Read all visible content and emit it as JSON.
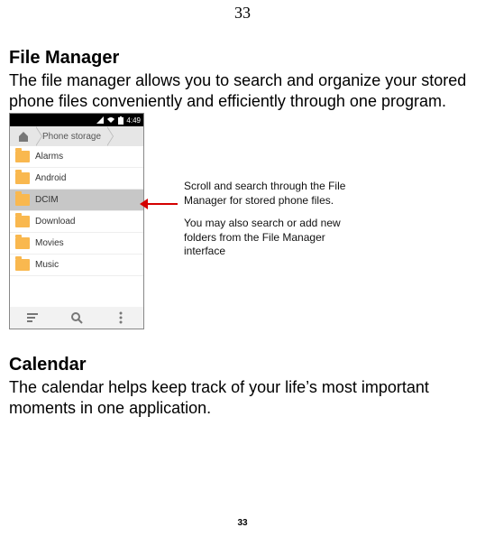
{
  "page_number_top": "33",
  "page_number_bottom": "33",
  "section1": {
    "title": "File Manager",
    "body": "The file manager allows you to search and organize your stored phone files conveniently and efficiently through one program."
  },
  "phone": {
    "breadcrumb": "Phone storage",
    "time": "4:49",
    "files": [
      {
        "name": "Alarms",
        "selected": false
      },
      {
        "name": "Android",
        "selected": false
      },
      {
        "name": "DCIM",
        "selected": true
      },
      {
        "name": "Download",
        "selected": false
      },
      {
        "name": "Movies",
        "selected": false
      },
      {
        "name": "Music",
        "selected": false
      }
    ]
  },
  "annotation": {
    "p1": "Scroll and search through the File Manager for stored phone files.",
    "p2": "You may also search or add new folders from the File Manager interface"
  },
  "section2": {
    "title": "Calendar",
    "body": "The calendar helps keep track of your life’s most important moments in one application."
  }
}
